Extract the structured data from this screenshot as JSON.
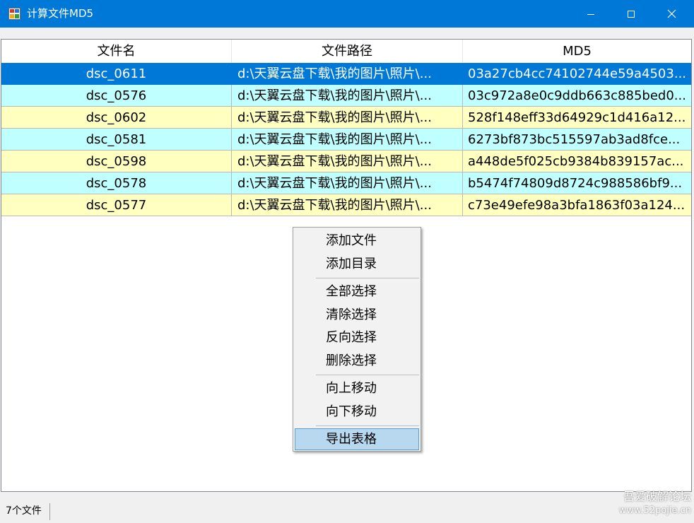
{
  "window": {
    "title": "计算文件MD5",
    "colors": {
      "titlebar": "#0078d7",
      "selected_row": "#0078d7",
      "row_cyan": "#c0ffff",
      "row_yellow": "#ffffc0"
    }
  },
  "table": {
    "columns": [
      "文件名",
      "文件路径",
      "MD5"
    ],
    "rows": [
      {
        "name": "dsc_0611",
        "path": "d:\\天翼云盘下载\\我的图片\\照片\\...",
        "md5": "03a27cb4cc74102744e59a4503...",
        "selected": true
      },
      {
        "name": "dsc_0576",
        "path": "d:\\天翼云盘下载\\我的图片\\照片\\...",
        "md5": "03c972a8e0c9ddb663c885bed0..."
      },
      {
        "name": "dsc_0602",
        "path": "d:\\天翼云盘下载\\我的图片\\照片\\...",
        "md5": "528f148eff33d64929c1d416a12..."
      },
      {
        "name": "dsc_0581",
        "path": "d:\\天翼云盘下载\\我的图片\\照片\\...",
        "md5": "6273bf873bc515597ab3ad8fce..."
      },
      {
        "name": "dsc_0598",
        "path": "d:\\天翼云盘下载\\我的图片\\照片\\...",
        "md5": "a448de5f025cb9384b839157ac..."
      },
      {
        "name": "dsc_0578",
        "path": "d:\\天翼云盘下载\\我的图片\\照片\\...",
        "md5": "b5474f74809d8724c988586bf9..."
      },
      {
        "name": "dsc_0577",
        "path": "d:\\天翼云盘下载\\我的图片\\照片\\...",
        "md5": "c73e49efe98a3bfa1863f03a124..."
      }
    ]
  },
  "context_menu": {
    "groups": [
      [
        "添加文件",
        "添加目录"
      ],
      [
        "全部选择",
        "清除选择",
        "反向选择",
        "删除选择"
      ],
      [
        "向上移动",
        "向下移动"
      ],
      [
        "导出表格"
      ]
    ],
    "highlighted": "导出表格"
  },
  "status": {
    "file_count": "7个文件"
  },
  "watermark": {
    "line1": "吾爱破解论坛",
    "line2": "www.52pojie.cn"
  }
}
